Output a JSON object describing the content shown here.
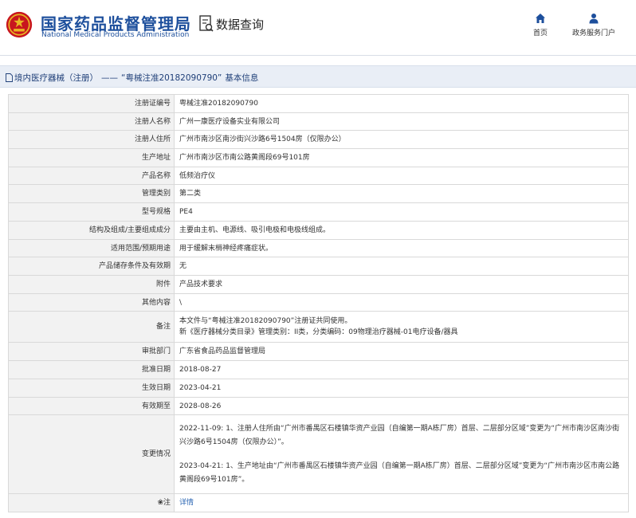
{
  "header": {
    "site_title": "国家药品监督管理局",
    "site_subtitle": "National Medical Products Administration",
    "query_label": "数据查询",
    "nav": [
      {
        "label": "首页",
        "icon": "home-icon"
      },
      {
        "label": "政务服务门户",
        "icon": "user-icon"
      }
    ]
  },
  "breadcrumb": {
    "category": "境内医疗器械（注册）",
    "separator": "——",
    "reg_quote": "“粤械注准20182090790”",
    "suffix": "基本信息"
  },
  "record": {
    "rows": [
      {
        "label": "注册证编号",
        "value": "粤械注准20182090790"
      },
      {
        "label": "注册人名称",
        "value": "广州一康医疗设备实业有限公司"
      },
      {
        "label": "注册人住所",
        "value": "广州市南沙区南沙街兴沙路6号1504房（仅限办公）"
      },
      {
        "label": "生产地址",
        "value": "广州市南沙区市南公路黄阁段69号101房"
      },
      {
        "label": "产品名称",
        "value": "低频治疗仪"
      },
      {
        "label": "管理类别",
        "value": "第二类"
      },
      {
        "label": "型号规格",
        "value": "PE4"
      },
      {
        "label": "结构及组成/主要组成成分",
        "value": "主要由主机、电源线、吸引电极和电极线组成。"
      },
      {
        "label": "适用范围/预期用途",
        "value": "用于缓解末梢神经疼痛症状。"
      },
      {
        "label": "产品储存条件及有效期",
        "value": "无"
      },
      {
        "label": "附件",
        "value": "产品技术要求"
      },
      {
        "label": "其他内容",
        "value": "\\"
      }
    ],
    "remark": {
      "label": "备注",
      "line1": "本文件与“粤械注准20182090790”注册证共同使用。",
      "line2": "新《医疗器械分类目录》管理类别：II类，分类编码：09物理治疗器械-01电疗设备/器具"
    },
    "rows2": [
      {
        "label": "审批部门",
        "value": "广东省食品药品监督管理局"
      },
      {
        "label": "批准日期",
        "value": "2018-08-27"
      },
      {
        "label": "生效日期",
        "value": "2023-04-21"
      },
      {
        "label": "有效期至",
        "value": "2028-08-26"
      }
    ],
    "changes": {
      "label": "变更情况",
      "entry1": "2022-11-09: 1、注册人住所由“广州市番禺区石楼镇华资产业园（自编第一期A栋厂房）首层、二层部分区域”变更为“广州市南沙区南沙街兴沙路6号1504房（仅限办公）”。",
      "entry2": "2023-04-21: 1、生产地址由“广州市番禺区石楼镇华资产业园（自编第一期A栋厂房）首层、二层部分区域”变更为“广州市南沙区市南公路黄阁段69号101房”。"
    },
    "note": {
      "label": "注",
      "link": "详情"
    }
  },
  "colors": {
    "brand": "#1d4f9c",
    "bar_bg": "#e9eef6",
    "label_bg": "#f2f2f2",
    "link": "#2b66b3"
  }
}
